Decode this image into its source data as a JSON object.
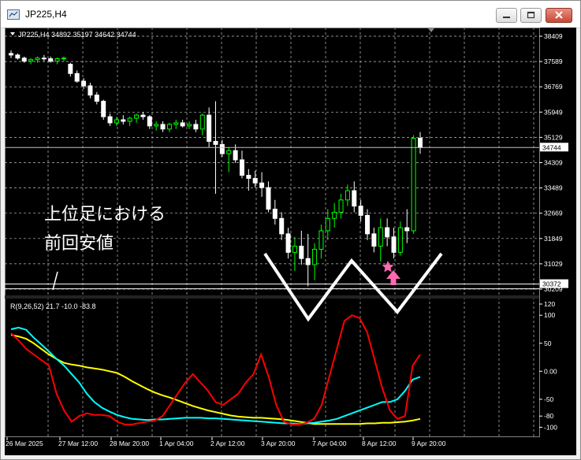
{
  "window": {
    "title": "JP225,H4"
  },
  "chart_info": "JP225,H4  34892 35197 34642 34744",
  "price_axis": [
    "38409",
    "37589",
    "36769",
    "35949",
    "35129",
    "34309",
    "33489",
    "32669",
    "31849",
    "31029",
    "30209"
  ],
  "current_price": "34744",
  "line_price_label": "30372",
  "time_axis": [
    "26 Mar 2025",
    "27 Mar 12:00",
    "28 Mar 20:00",
    "1 Apr 04:00",
    "2 Apr 12:00",
    "3 Apr 20:00",
    "7 Apr 04:00",
    "8 Apr 12:00",
    "9 Apr 20:00"
  ],
  "annotation": {
    "line1": "上位足における",
    "line2": "前回安値"
  },
  "indicator_info": "R(9,26,52) 21.7 -10.0 -83.8",
  "indicator_axis": [
    "120",
    "100",
    "50",
    "0.00",
    "-50",
    "-80",
    "-100"
  ],
  "colors": {
    "background": "#000000",
    "bull": "#00ff00",
    "bear": "#ffffff",
    "grid": "#c0c0c0",
    "fast": "#ff0000",
    "mid": "#00ffff",
    "slow": "#ffff00",
    "marker": "#ff69b4"
  },
  "chart_data": [
    {
      "type": "candlestick",
      "symbol": "JP225",
      "timeframe": "H4",
      "ylim": [
        30209,
        38409
      ],
      "ohlc": [
        [
          37850,
          37950,
          37700,
          37800
        ],
        [
          37800,
          37850,
          37650,
          37700
        ],
        [
          37700,
          37750,
          37550,
          37600
        ],
        [
          37600,
          37700,
          37500,
          37650
        ],
        [
          37650,
          37750,
          37550,
          37700
        ],
        [
          37700,
          37800,
          37600,
          37680
        ],
        [
          37680,
          37750,
          37550,
          37600
        ],
        [
          37600,
          37720,
          37500,
          37680
        ],
        [
          37680,
          37750,
          37600,
          37700
        ],
        [
          37500,
          37550,
          37100,
          37200
        ],
        [
          37200,
          37300,
          36900,
          36950
        ],
        [
          36950,
          37050,
          36700,
          36800
        ],
        [
          36800,
          36900,
          36400,
          36500
        ],
        [
          36500,
          36600,
          36200,
          36300
        ],
        [
          36300,
          36350,
          35700,
          35800
        ],
        [
          35800,
          35900,
          35500,
          35600
        ],
        [
          35600,
          35800,
          35500,
          35700
        ],
        [
          35700,
          35850,
          35550,
          35650
        ],
        [
          35650,
          35800,
          35500,
          35750
        ],
        [
          35750,
          35900,
          35600,
          35850
        ],
        [
          35850,
          35950,
          35700,
          35800
        ],
        [
          35800,
          35850,
          35400,
          35500
        ],
        [
          35500,
          35650,
          35350,
          35550
        ],
        [
          35550,
          35650,
          35300,
          35400
        ],
        [
          35400,
          35600,
          35300,
          35550
        ],
        [
          35550,
          35700,
          35400,
          35600
        ],
        [
          35600,
          35700,
          35450,
          35500
        ],
        [
          35500,
          35650,
          35400,
          35550
        ],
        [
          35550,
          35700,
          35300,
          35400
        ],
        [
          35400,
          35900,
          35200,
          35850
        ],
        [
          35850,
          36100,
          34800,
          35000
        ],
        [
          35000,
          36300,
          33300,
          34900
        ],
        [
          34900,
          35050,
          34500,
          34600
        ],
        [
          34600,
          34800,
          34000,
          34700
        ],
        [
          34700,
          34900,
          34300,
          34400
        ],
        [
          34400,
          34700,
          33800,
          33900
        ],
        [
          33900,
          34100,
          33400,
          33800
        ],
        [
          33800,
          34050,
          33500,
          33650
        ],
        [
          33650,
          34000,
          33200,
          33500
        ],
        [
          33500,
          33700,
          32700,
          32800
        ],
        [
          32800,
          33100,
          32300,
          32500
        ],
        [
          32500,
          32700,
          31800,
          32000
        ],
        [
          32000,
          32200,
          31200,
          31400
        ],
        [
          31400,
          31900,
          30800,
          31600
        ],
        [
          31600,
          32100,
          31000,
          31200
        ],
        [
          31200,
          32000,
          30300,
          31000
        ],
        [
          31000,
          31700,
          30500,
          31500
        ],
        [
          31500,
          32300,
          31200,
          32100
        ],
        [
          32100,
          32800,
          31800,
          32500
        ],
        [
          32500,
          33000,
          32200,
          32700
        ],
        [
          32700,
          33300,
          32500,
          33100
        ],
        [
          33100,
          33600,
          32900,
          33400
        ],
        [
          33400,
          33700,
          32700,
          32900
        ],
        [
          32900,
          33100,
          32400,
          32600
        ],
        [
          32600,
          32800,
          31800,
          32000
        ],
        [
          32000,
          32200,
          31400,
          31600
        ],
        [
          31600,
          32500,
          31100,
          32200
        ],
        [
          32200,
          32500,
          31600,
          31900
        ],
        [
          31900,
          32200,
          31200,
          31400
        ],
        [
          31400,
          32400,
          31300,
          32200
        ],
        [
          32200,
          32800,
          31700,
          32100
        ],
        [
          32100,
          35200,
          32000,
          35100
        ],
        [
          35100,
          35300,
          34600,
          34800
        ]
      ],
      "horizontal_line": 30372
    },
    {
      "type": "line",
      "name": "R(9,26,52)",
      "ylim": [
        -105,
        120
      ],
      "series": [
        {
          "name": "fast",
          "values": [
            68,
            55,
            40,
            30,
            20,
            10,
            -40,
            -70,
            -90,
            -80,
            -75,
            -78,
            -78,
            -80,
            -90,
            -95,
            -95,
            -92,
            -90,
            -88,
            -80,
            -60,
            -40,
            -20,
            -5,
            -20,
            -35,
            -55,
            -60,
            -50,
            -40,
            -20,
            -5,
            30,
            -10,
            -60,
            -90,
            -95,
            -95,
            -92,
            -85,
            -60,
            -10,
            40,
            90,
            100,
            95,
            70,
            20,
            -30,
            -70,
            -85,
            -80,
            10,
            30
          ]
        },
        {
          "name": "mid",
          "values": [
            75,
            78,
            74,
            60,
            48,
            35,
            22,
            10,
            -5,
            -20,
            -40,
            -55,
            -65,
            -72,
            -78,
            -82,
            -85,
            -86,
            -87,
            -86,
            -86,
            -85,
            -84,
            -83,
            -83,
            -83,
            -84,
            -84,
            -85,
            -86,
            -87,
            -88,
            -89,
            -90,
            -91,
            -92,
            -93,
            -93,
            -94,
            -93,
            -92,
            -90,
            -88,
            -85,
            -80,
            -75,
            -70,
            -65,
            -60,
            -55,
            -55,
            -50,
            -35,
            -15,
            -10
          ]
        },
        {
          "name": "slow",
          "values": [
            65,
            62,
            58,
            50,
            40,
            30,
            22,
            15,
            12,
            10,
            7,
            5,
            3,
            0,
            -3,
            -10,
            -18,
            -25,
            -32,
            -38,
            -43,
            -47,
            -52,
            -57,
            -62,
            -66,
            -70,
            -73,
            -76,
            -79,
            -81,
            -82,
            -83,
            -83,
            -84,
            -85,
            -86,
            -88,
            -90,
            -92,
            -94,
            -94,
            -94,
            -94,
            -94,
            -94,
            -94,
            -93,
            -93,
            -92,
            -92,
            -91,
            -90,
            -88,
            -85
          ]
        }
      ]
    }
  ]
}
